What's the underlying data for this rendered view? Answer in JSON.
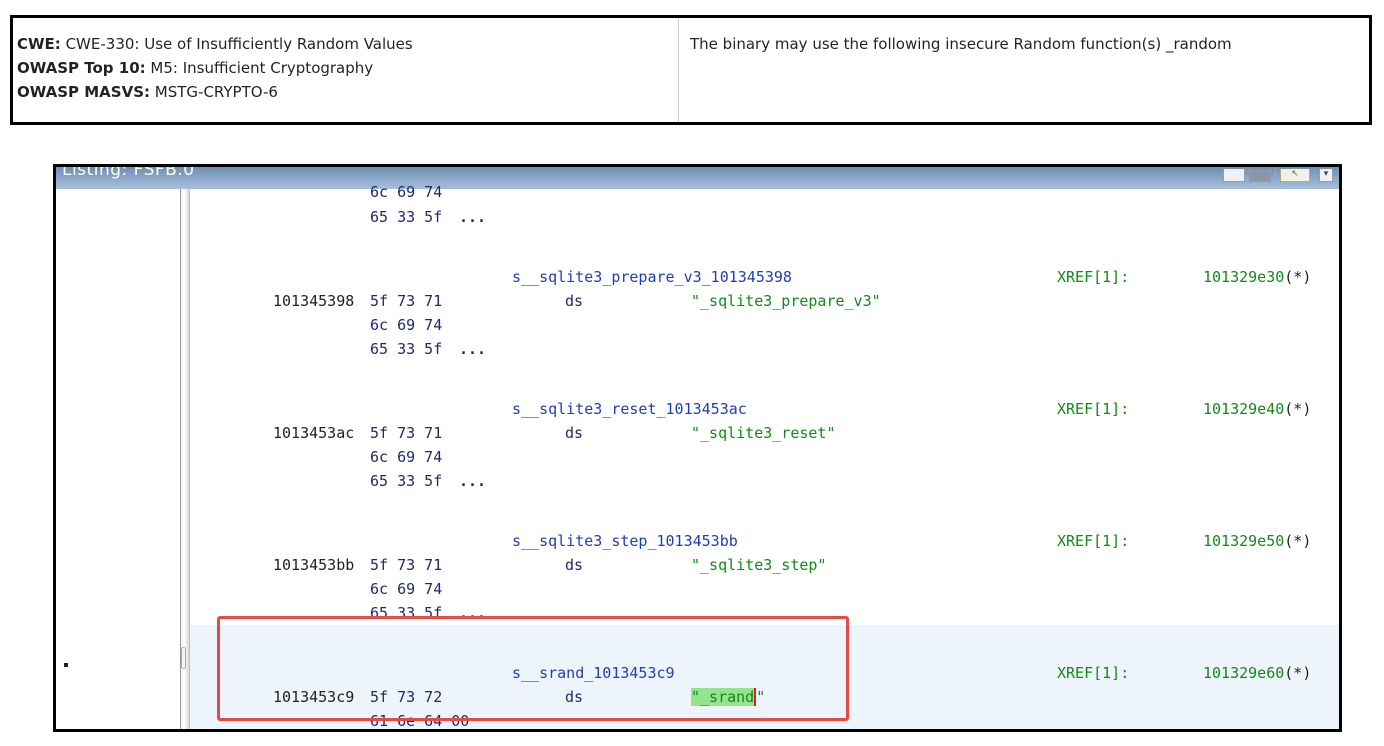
{
  "finding": {
    "cwe_label": "CWE:",
    "cwe_value": " CWE-330: Use of Insufficiently Random Values",
    "owasp_label": "OWASP Top 10:",
    "owasp_value": " M5: Insufficient Cryptography",
    "masvs_label": "OWASP MASVS:",
    "masvs_value": " MSTG-CRYPTO-6",
    "description": "The binary may use the following insecure Random function(s) _random"
  },
  "listing": {
    "title": "Listing:  FSFB.0",
    "partial_top_bytes": "6c 69 74",
    "first_tail": "65 33 5f",
    "ellipsis": "...",
    "entries": [
      {
        "label": "s__sqlite3_prepare_v3_101345398",
        "address": "101345398",
        "bytes1": "5f 73 71",
        "bytes2": "6c 69 74",
        "bytes3": "65 33 5f",
        "mnemonic": "ds",
        "string": "\"_sqlite3_prepare_v3\"",
        "xref": "XREF[1]:",
        "xref_addr": "101329e30",
        "xref_suffix": "(*)"
      },
      {
        "label": "s__sqlite3_reset_1013453ac",
        "address": "1013453ac",
        "bytes1": "5f 73 71",
        "bytes2": "6c 69 74",
        "bytes3": "65 33 5f",
        "mnemonic": "ds",
        "string": "\"_sqlite3_reset\"",
        "xref": "XREF[1]:",
        "xref_addr": "101329e40",
        "xref_suffix": "(*)"
      },
      {
        "label": "s__sqlite3_step_1013453bb",
        "address": "1013453bb",
        "bytes1": "5f 73 71",
        "bytes2": "6c 69 74",
        "bytes3": "65 33 5f",
        "mnemonic": "ds",
        "string": "\"_sqlite3_step\"",
        "xref": "XREF[1]:",
        "xref_addr": "101329e50",
        "xref_suffix": "(*)"
      }
    ],
    "selected": {
      "label": "s__srand_1013453c9",
      "address": "1013453c9",
      "bytes1": "5f 73 72",
      "bytes2": "61 6e 64 00",
      "mnemonic": "ds",
      "string_open": "\"",
      "string_body": "_srand",
      "string_close": "\"",
      "xref": "XREF[1]:",
      "xref_addr": "101329e60",
      "xref_suffix": "(*)"
    }
  },
  "icons": [
    "restore-icon",
    "window-icon",
    "cursor-icon",
    "dropdown-icon"
  ],
  "colors": {
    "highlight_box": "#e34b45",
    "string_green": "#138a16",
    "label_blue": "#1f3fb4",
    "selected_row_bg": "#eef4fb",
    "string_selection": "#93e38f"
  }
}
